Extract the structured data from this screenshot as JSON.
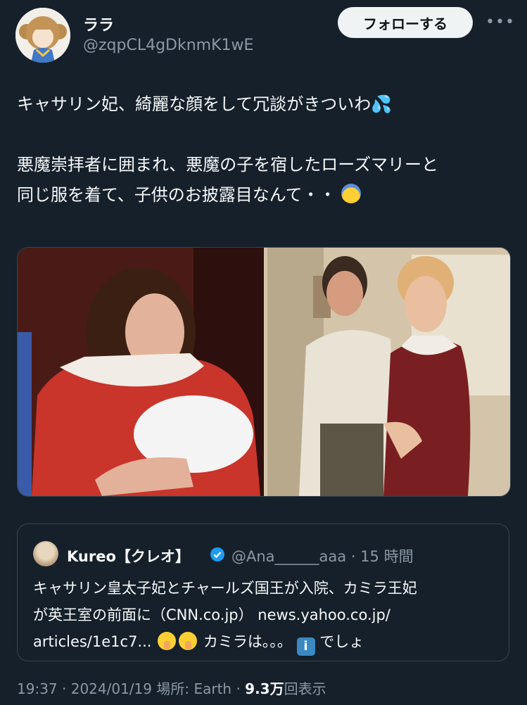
{
  "author": {
    "name": "ララ",
    "handle": "@zqpCL4gDknmK1wE"
  },
  "follow_label": "フォローする",
  "more_icon": "more-horizontal-icon",
  "tweet": {
    "line1": "キャサリン妃、綺麗な顔をして冗談がきついわ",
    "line1_emoji": "💦",
    "line2": "悪魔崇拝者に囲まれ、悪魔の子を宿したローズマリーと",
    "line3": "同じ服を着て、子供のお披露目なんて・・"
  },
  "quote": {
    "name": "Kureo【クレオ】",
    "handle_time": "@Ana______aaa · 15 時間",
    "line1": "キャサリン皇太子妃とチャールズ国王が入院、カミラ王妃",
    "line2": "が英王室の前面に（CNN.co.jp） news.yahoo.co.jp/",
    "line3_a": "articles/1e1c7... ",
    "line3_b": "カミラは。。。",
    "line3_c": "でしょ"
  },
  "meta": {
    "time": "19:37",
    "date": "2024/01/19",
    "location": "場所: Earth",
    "views_number": "9.3",
    "views_unit": "万",
    "views_suffix": "回表示"
  },
  "colors": {
    "background": "#15202b",
    "text": "#f7f9f9",
    "muted": "#8b98a5",
    "border": "#38444d",
    "verified": "#1d9bf0"
  }
}
